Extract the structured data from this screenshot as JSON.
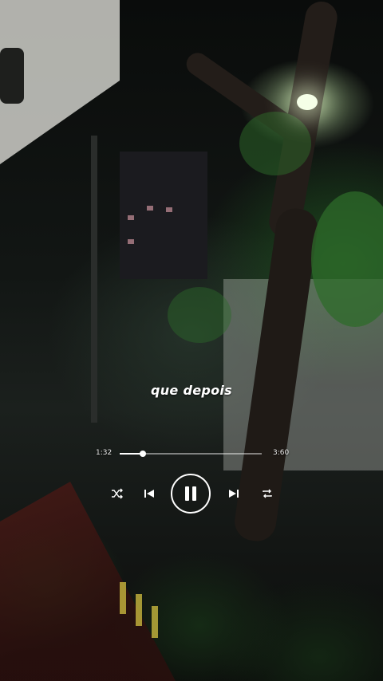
{
  "player": {
    "lyric": "que depois",
    "elapsed": "1:32",
    "duration": "3:60",
    "progress_fraction": 0.165
  },
  "icons": {
    "shuffle": "shuffle-icon",
    "previous": "skip-previous-icon",
    "pause": "pause-icon",
    "next": "skip-next-icon",
    "repeat": "repeat-icon"
  },
  "colors": {
    "controls": "#ffffff",
    "track": "#ffffff"
  }
}
